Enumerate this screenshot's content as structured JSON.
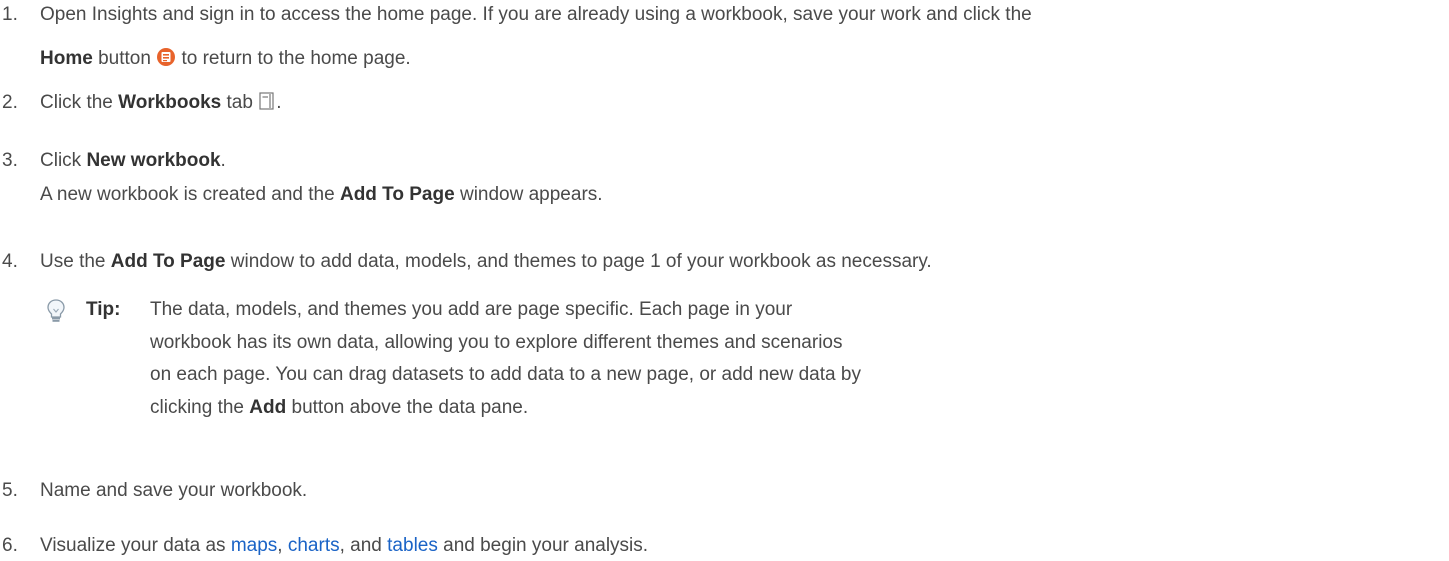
{
  "steps": [
    {
      "number": "1.",
      "t1": "Open Insights and sign in to access the home page. If you are already using a workbook, save your work and click the",
      "b1": "Home",
      "t2": " button ",
      "t3": " to return to the home page.",
      "icon": "home-icon"
    },
    {
      "number": "2.",
      "t1": "Click the ",
      "b1": "Workbooks",
      "t2": " tab ",
      "t3": ".",
      "icon": "workbooks-tab-icon"
    },
    {
      "number": "3.",
      "t1": "Click ",
      "b1": "New workbook",
      "t2": ".",
      "l2_t1": "A new workbook is created and the ",
      "l2_b1": "Add To Page",
      "l2_t2": " window appears."
    },
    {
      "number": "4.",
      "t1": "Use the ",
      "b1": "Add To Page",
      "t2": " window to add data, models, and themes to page 1 of your workbook as necessary."
    },
    {
      "number": "5.",
      "t1": "Name and save your workbook."
    },
    {
      "number": "6.",
      "t1": "Visualize your data as ",
      "link1": "maps",
      "sep1": ", ",
      "link2": "charts",
      "sep2": ", and ",
      "link3": "tables",
      "t2": " and begin your analysis."
    }
  ],
  "tip": {
    "label": "Tip:",
    "icon": "lightbulb-icon",
    "line1": "The data, models, and themes you add are page specific. Each page in your",
    "line2": "workbook has its own data, allowing you to explore different themes and scenarios",
    "line3": "on each page. You can drag datasets to add data to a new page, or add new data by",
    "line4_pre": "clicking the ",
    "line4_bold": "Add",
    "line4_post": " button above the data pane."
  },
  "colors": {
    "text": "#4a4a4a",
    "link": "#1a63c6",
    "home_icon": "#e8632b"
  }
}
